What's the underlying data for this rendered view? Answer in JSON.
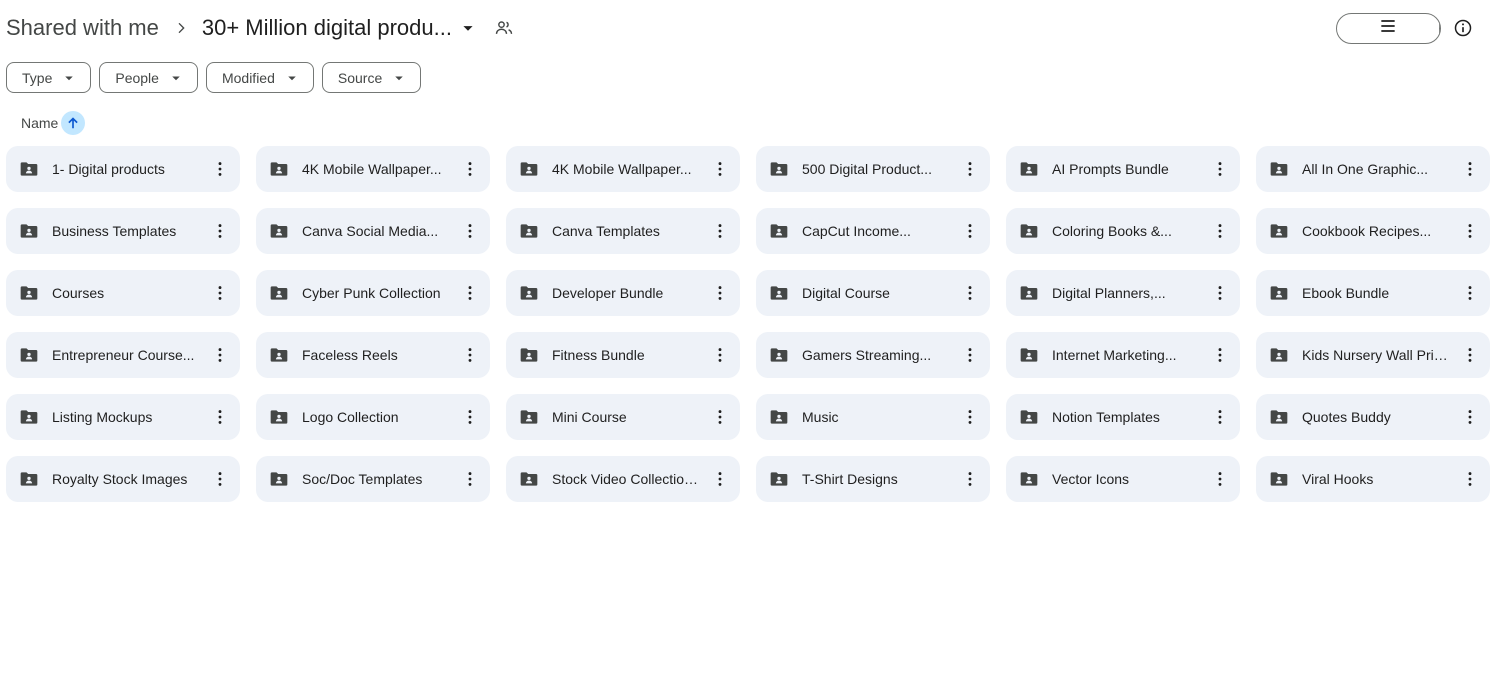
{
  "breadcrumb": {
    "root": "Shared with me",
    "current": "30+ Million digital produ..."
  },
  "filters": [
    {
      "label": "Type"
    },
    {
      "label": "People"
    },
    {
      "label": "Modified"
    },
    {
      "label": "Source"
    }
  ],
  "sort": {
    "label": "Name",
    "direction": "ascending"
  },
  "view": {
    "selected": "grid"
  },
  "folders": [
    "1- Digital products",
    "4K Mobile Wallpaper...",
    "4K Mobile Wallpaper...",
    "500 Digital Product...",
    "AI Prompts Bundle",
    "All In One Graphic...",
    "Business Templates",
    "Canva Social Media...",
    "Canva Templates",
    "CapCut Income...",
    "Coloring Books &...",
    "Cookbook Recipes...",
    "Courses",
    "Cyber Punk Collection",
    "Developer Bundle",
    "Digital Course",
    "Digital Planners,...",
    "Ebook Bundle",
    "Entrepreneur Course...",
    "Faceless Reels",
    "Fitness Bundle",
    "Gamers Streaming...",
    "Internet Marketing...",
    "Kids Nursery Wall Prints",
    "Listing Mockups",
    "Logo Collection",
    "Mini Course",
    "Music",
    "Notion Templates",
    "Quotes Buddy",
    "Royalty Stock Images",
    "Soc/Doc Templates",
    "Stock Video Collection...",
    "T-Shirt Designs",
    "Vector Icons",
    "Viral Hooks"
  ],
  "icons": {
    "folder": "shared-folder-icon",
    "more": "more-vert-icon",
    "share": "people-icon",
    "info": "info-icon"
  },
  "colors": {
    "card_bg": "#eef2f8",
    "selected_bg": "#c2e7ff",
    "text": "#1f1f1f",
    "muted": "#444746"
  }
}
